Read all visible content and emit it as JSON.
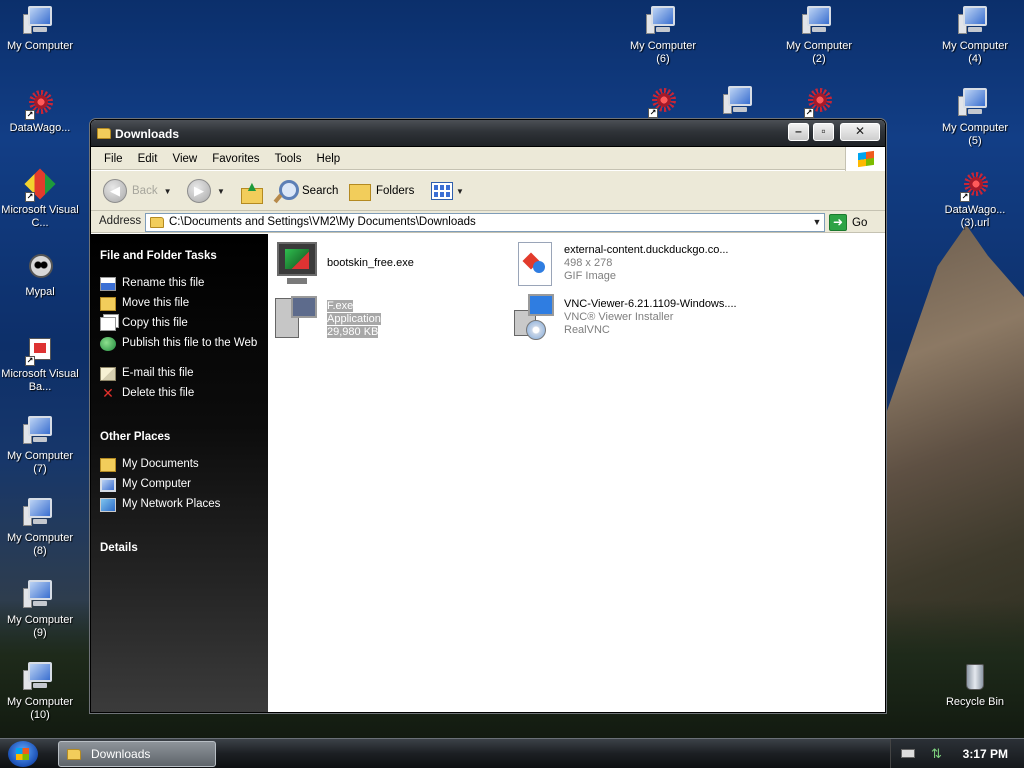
{
  "desktop": {
    "icons": {
      "my_computer": "My Computer",
      "datawago": "DataWago...",
      "vs": "Microsoft Visual C...",
      "mypal": "Mypal",
      "vb": "Microsoft Visual Ba...",
      "mc7": "My Computer (7)",
      "mc8": "My Computer (8)",
      "mc9": "My Computer (9)",
      "mc10": "My Computer (10)",
      "mc6": "My Computer (6)",
      "mc2": "My Computer (2)",
      "mc4": "My Computer (4)",
      "mc5": "My Computer (5)",
      "datawago3": "DataWago... (3).url",
      "recycle": "Recycle Bin"
    }
  },
  "window": {
    "title": "Downloads",
    "menu": [
      "File",
      "Edit",
      "View",
      "Favorites",
      "Tools",
      "Help"
    ],
    "toolbar": {
      "back": "Back",
      "search": "Search",
      "folders": "Folders"
    },
    "address": {
      "label": "Address",
      "value": "C:\\Documents and Settings\\VM2\\My Documents\\Downloads",
      "go": "Go"
    },
    "tasks": {
      "file_folder_tasks": "File and Folder Tasks",
      "rename": "Rename this file",
      "move": "Move this file",
      "copy": "Copy this file",
      "publish": "Publish this file to the Web",
      "email": "E-mail this file",
      "delete": "Delete this file",
      "other_places": "Other Places",
      "my_documents": "My Documents",
      "my_computer": "My Computer",
      "my_network": "My Network Places",
      "details": "Details"
    },
    "files": [
      {
        "name": "bootskin_free.exe",
        "line2": "",
        "line3": ""
      },
      {
        "name": "external-content.duckduckgo.co...",
        "line2": "498 x 278",
        "line3": "GIF Image"
      },
      {
        "name": "F.exe",
        "line2": "Application",
        "line3": "29,980 KB"
      },
      {
        "name": "VNC-Viewer-6.21.1109-Windows....",
        "line2": "VNC® Viewer Installer",
        "line3": "RealVNC"
      }
    ]
  },
  "taskbar": {
    "task": "Downloads",
    "clock": "3:17 PM"
  },
  "colors": {
    "accent": "#3b6fd4",
    "task_pane": "#000000",
    "selection": "#c9c9c9"
  }
}
